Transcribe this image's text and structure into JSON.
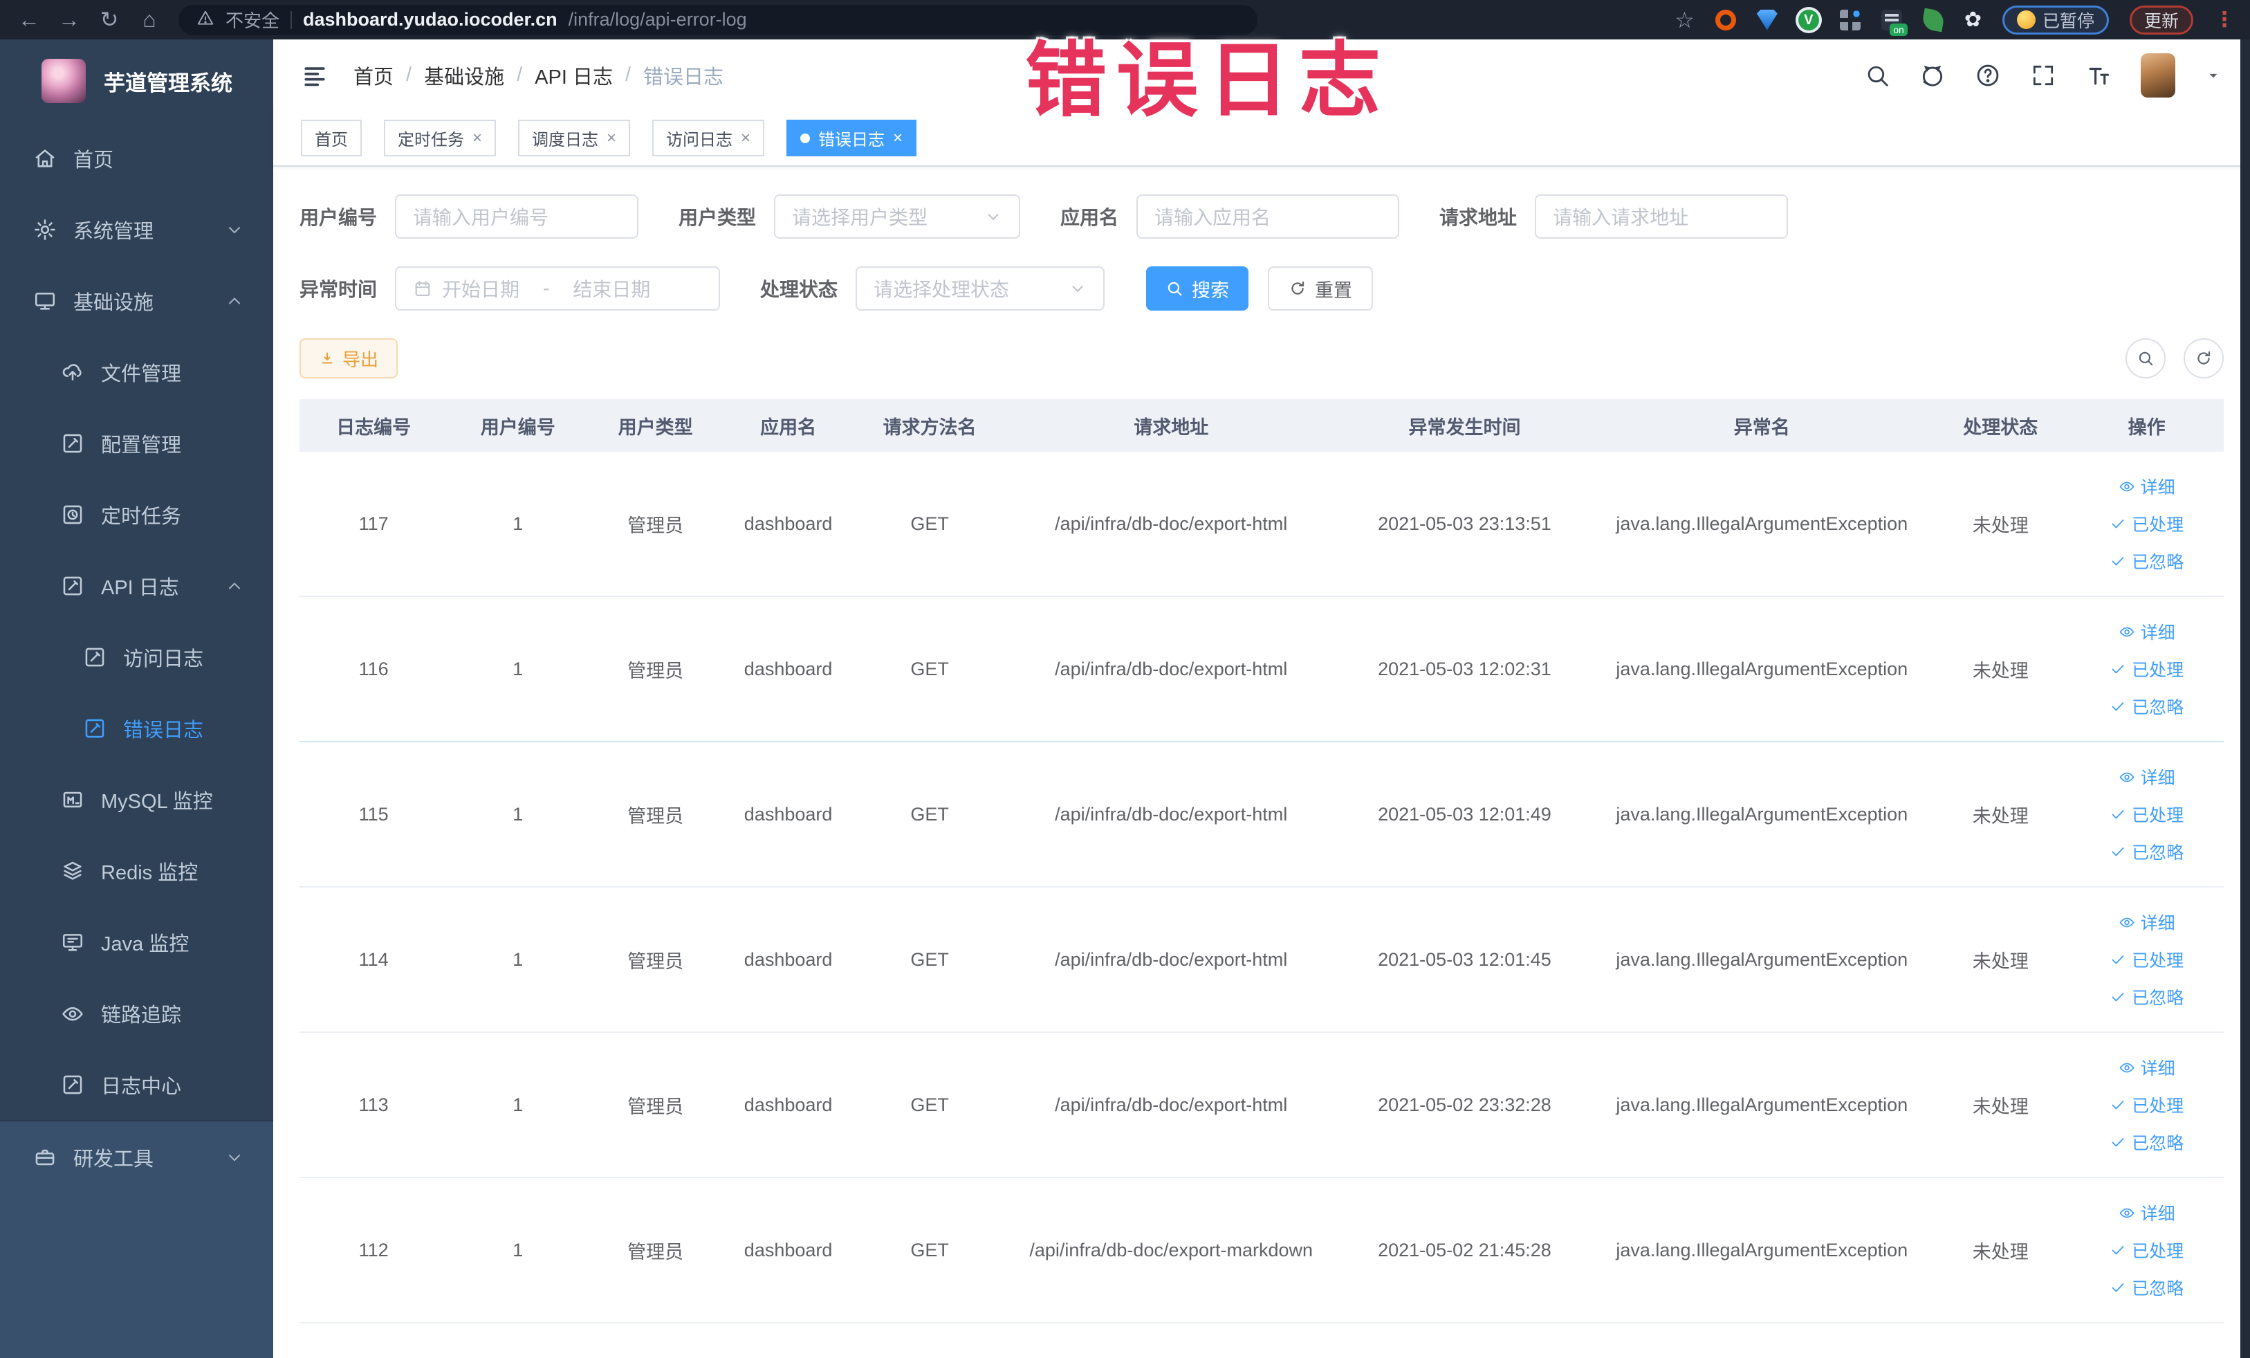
{
  "browser": {
    "security_label": "不安全",
    "url_domain": "dashboard.yudao.iocoder.cn",
    "url_path": "/infra/log/api-error-log",
    "on_badge": "on",
    "paused_badge": "已暂停",
    "update_badge": "更新"
  },
  "overlay": {
    "text": "错误日志",
    "color": "#e5335b"
  },
  "sidebar": {
    "title": "芋道管理系统",
    "items": [
      {
        "key": "home",
        "label": "首页",
        "icon": "home",
        "level": 1
      },
      {
        "key": "system-mgmt",
        "label": "系统管理",
        "icon": "gear",
        "level": 1,
        "chevron": "down"
      },
      {
        "key": "infra",
        "label": "基础设施",
        "icon": "monitor",
        "level": 1,
        "chevron": "up"
      },
      {
        "key": "file-mgmt",
        "label": "文件管理",
        "icon": "cloudup",
        "level": 2
      },
      {
        "key": "config-mgmt",
        "label": "配置管理",
        "icon": "pensq",
        "level": 2
      },
      {
        "key": "scheduled-job",
        "label": "定时任务",
        "icon": "clocksq",
        "level": 2
      },
      {
        "key": "api-log",
        "label": "API 日志",
        "icon": "pensq",
        "level": 2,
        "chevron": "up"
      },
      {
        "key": "access-log",
        "label": "访问日志",
        "icon": "pensq",
        "level": 3
      },
      {
        "key": "error-log",
        "label": "错误日志",
        "icon": "pensq",
        "level": 3,
        "active": true
      },
      {
        "key": "mysql-monitor",
        "label": "MySQL 监控",
        "icon": "mysql",
        "level": 2
      },
      {
        "key": "redis-monitor",
        "label": "Redis 监控",
        "icon": "redis",
        "level": 2
      },
      {
        "key": "java-monitor",
        "label": "Java 监控",
        "icon": "javamon",
        "level": 2
      },
      {
        "key": "trace",
        "label": "链路追踪",
        "icon": "eye",
        "level": 2
      },
      {
        "key": "log-center",
        "label": "日志中心",
        "icon": "pensq",
        "level": 2
      },
      {
        "key": "dev-tools",
        "label": "研发工具",
        "icon": "briefcase",
        "level": 1,
        "chevron": "down",
        "section": "bottom"
      }
    ]
  },
  "breadcrumb": [
    "首页",
    "基础设施",
    "API 日志",
    "错误日志"
  ],
  "tabs": [
    {
      "label": "首页",
      "closable": false,
      "active": false
    },
    {
      "label": "定时任务",
      "closable": true,
      "active": false
    },
    {
      "label": "调度日志",
      "closable": true,
      "active": false
    },
    {
      "label": "访问日志",
      "closable": true,
      "active": false
    },
    {
      "label": "错误日志",
      "closable": true,
      "active": true
    }
  ],
  "filters": {
    "user_id": {
      "label": "用户编号",
      "placeholder": "请输入用户编号"
    },
    "user_type": {
      "label": "用户类型",
      "placeholder": "请选择用户类型"
    },
    "app_name": {
      "label": "应用名",
      "placeholder": "请输入应用名"
    },
    "request_url": {
      "label": "请求地址",
      "placeholder": "请输入请求地址"
    },
    "exception_time": {
      "label": "异常时间",
      "start_placeholder": "开始日期",
      "separator": "-",
      "end_placeholder": "结束日期"
    },
    "process_status": {
      "label": "处理状态",
      "placeholder": "请选择处理状态"
    },
    "search_label": "搜索",
    "reset_label": "重置"
  },
  "toolbar": {
    "export_label": "导出"
  },
  "table": {
    "headers": [
      "日志编号",
      "用户编号",
      "用户类型",
      "应用名",
      "请求方法名",
      "请求地址",
      "异常发生时间",
      "异常名",
      "处理状态",
      "操作"
    ],
    "action_labels": [
      "详细",
      "已处理",
      "已忽略"
    ],
    "rows": [
      {
        "id": "117",
        "user_id": "1",
        "user_type": "管理员",
        "app": "dashboard",
        "method": "GET",
        "url": "/api/infra/db-doc/export-html",
        "time": "2021-05-03 23:13:51",
        "exception": "java.lang.IllegalArgumentException",
        "status": "未处理"
      },
      {
        "id": "116",
        "user_id": "1",
        "user_type": "管理员",
        "app": "dashboard",
        "method": "GET",
        "url": "/api/infra/db-doc/export-html",
        "time": "2021-05-03 12:02:31",
        "exception": "java.lang.IllegalArgumentException",
        "status": "未处理"
      },
      {
        "id": "115",
        "user_id": "1",
        "user_type": "管理员",
        "app": "dashboard",
        "method": "GET",
        "url": "/api/infra/db-doc/export-html",
        "time": "2021-05-03 12:01:49",
        "exception": "java.lang.IllegalArgumentException",
        "status": "未处理"
      },
      {
        "id": "114",
        "user_id": "1",
        "user_type": "管理员",
        "app": "dashboard",
        "method": "GET",
        "url": "/api/infra/db-doc/export-html",
        "time": "2021-05-03 12:01:45",
        "exception": "java.lang.IllegalArgumentException",
        "status": "未处理"
      },
      {
        "id": "113",
        "user_id": "1",
        "user_type": "管理员",
        "app": "dashboard",
        "method": "GET",
        "url": "/api/infra/db-doc/export-html",
        "time": "2021-05-02 23:32:28",
        "exception": "java.lang.IllegalArgumentException",
        "status": "未处理"
      },
      {
        "id": "112",
        "user_id": "1",
        "user_type": "管理员",
        "app": "dashboard",
        "method": "GET",
        "url": "/api/infra/db-doc/export-markdown",
        "time": "2021-05-02 21:45:28",
        "exception": "java.lang.IllegalArgumentException",
        "status": "未处理"
      }
    ]
  },
  "colors": {
    "accent": "#409EFF",
    "warning": "#e6a23c",
    "sidebar_bg": "#2f4156"
  }
}
